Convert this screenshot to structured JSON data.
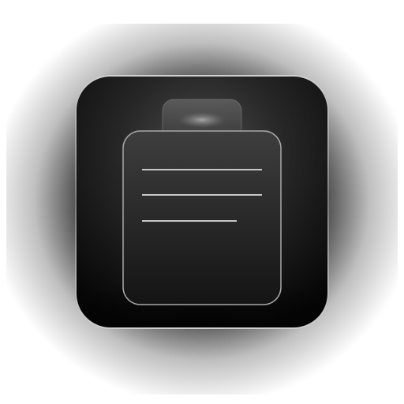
{
  "icon": {
    "name": "clipboard-icon",
    "colors": {
      "background": "#ffffff",
      "tile_dark": "#0b0b0b",
      "tile_mid": "#3a3a3a",
      "tile_rim": "#bdbdbd",
      "clip": "#555555",
      "clip_highlight": "#9a9a9a",
      "line": "#c8c8c8"
    }
  }
}
